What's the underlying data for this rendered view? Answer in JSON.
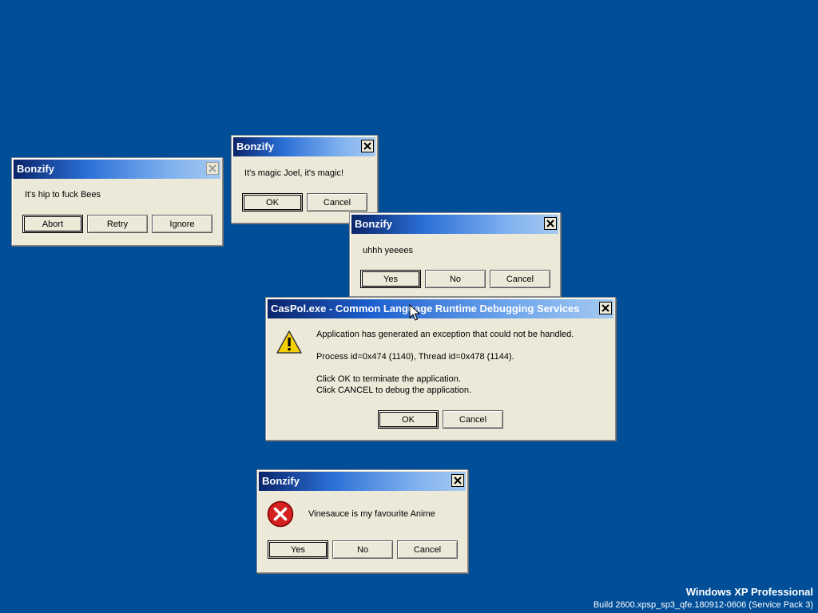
{
  "desktop": {
    "background_color": "#004e98"
  },
  "dialogs": {
    "bees": {
      "title": "Bonzify",
      "message": "It's hip to fuck Bees",
      "buttons": [
        "Abort",
        "Retry",
        "Ignore"
      ],
      "close_icon": "close-icon"
    },
    "magic": {
      "title": "Bonzify",
      "message": "It's magic Joel, it's magic!",
      "buttons": [
        "OK",
        "Cancel"
      ],
      "close_icon": "close-icon"
    },
    "yes": {
      "title": "Bonzify",
      "message": "uhhh yeeees",
      "buttons": [
        "Yes",
        "No",
        "Cancel"
      ],
      "close_icon": "close-icon"
    },
    "caspol": {
      "title": "CasPol.exe - Common Language Runtime Debugging Services",
      "icon": "warning-icon",
      "line1": "Application has generated an exception that could not be handled.",
      "line2": "Process id=0x474 (1140), Thread id=0x478 (1144).",
      "line3": "Click OK to terminate the application.",
      "line4": "Click CANCEL to debug the application.",
      "buttons": [
        "OK",
        "Cancel"
      ],
      "close_icon": "close-icon"
    },
    "vinesauce": {
      "title": "Bonzify",
      "icon": "error-icon",
      "message": "Vinesauce is my favourite Anime",
      "buttons": [
        "Yes",
        "No",
        "Cancel"
      ],
      "close_icon": "close-icon"
    }
  },
  "watermark": {
    "edition": "Windows XP Professional",
    "build": "Build 2600.xpsp_sp3_qfe.180912-0606 (Service Pack 3)"
  },
  "colors": {
    "title_gradient_start": "#0a246a",
    "title_gradient_end": "#a6caf0",
    "dialog_face": "#ece9d8",
    "error_red": "#d42020",
    "warning_yellow": "#f5d000"
  }
}
